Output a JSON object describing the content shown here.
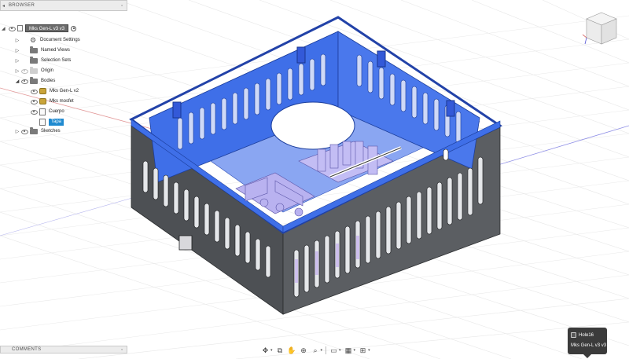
{
  "browser": {
    "title": "BROWSER",
    "document_name": "Mks Gen-L v3 v3",
    "items": [
      {
        "label": "Document Settings"
      },
      {
        "label": "Named Views"
      },
      {
        "label": "Selection Sets"
      },
      {
        "label": "Origin"
      },
      {
        "label": "Bodies"
      },
      {
        "label": "Mks Gen-L v2"
      },
      {
        "label": "Mks mosfet"
      },
      {
        "label": "Cuerpo"
      },
      {
        "label": "Tapa"
      },
      {
        "label": "Sketches"
      }
    ]
  },
  "comments": {
    "title": "COMMENTS"
  },
  "tooltip": {
    "feature": "Hole16",
    "component": "Mks Gen-L v3 v3"
  },
  "colors": {
    "selection_blue": "#3f6fe8",
    "box_gray": "#55585b",
    "browser_highlight": "#1f8ad0"
  },
  "toolbar_icons": [
    "orbit-icon",
    "look-at-icon",
    "pan-icon",
    "zoom-icon",
    "fit-icon",
    "display-settings-icon",
    "grid-settings-icon",
    "viewports-icon"
  ]
}
